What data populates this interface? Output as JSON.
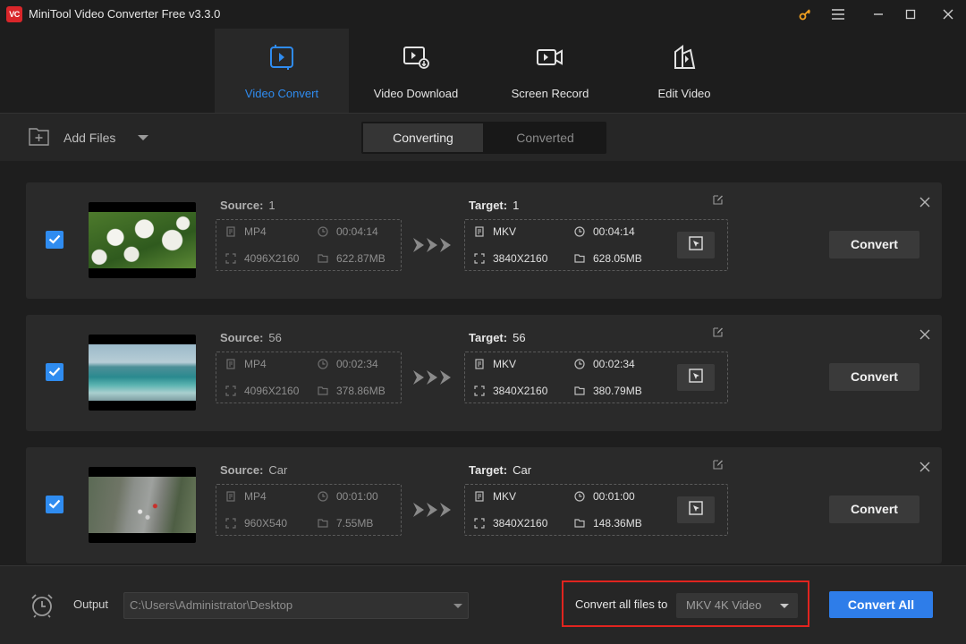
{
  "window": {
    "logo_text": "VC",
    "title": "MiniTool Video Converter Free v3.3.0"
  },
  "modules": [
    {
      "label": "Video Convert",
      "icon": "video-convert-icon",
      "active": true
    },
    {
      "label": "Video Download",
      "icon": "video-download-icon",
      "active": false
    },
    {
      "label": "Screen Record",
      "icon": "screen-record-icon",
      "active": false
    },
    {
      "label": "Edit Video",
      "icon": "edit-video-icon",
      "active": false
    }
  ],
  "toolbar": {
    "add_files_label": "Add Files",
    "tabs": [
      "Converting",
      "Converted"
    ],
    "active_tab": "Converting"
  },
  "files": [
    {
      "source_label": "Source:",
      "source_name": "1",
      "source_format": "MP4",
      "source_duration": "00:04:14",
      "source_resolution": "4096X2160",
      "source_size": "622.87MB",
      "target_label": "Target:",
      "target_name": "1",
      "target_format": "MKV",
      "target_duration": "00:04:14",
      "target_resolution": "3840X2160",
      "target_size": "628.05MB",
      "checked": true,
      "thumbnail": "white-flowers",
      "convert_label": "Convert"
    },
    {
      "source_label": "Source:",
      "source_name": "56",
      "source_format": "MP4",
      "source_duration": "00:02:34",
      "source_resolution": "4096X2160",
      "source_size": "378.86MB",
      "target_label": "Target:",
      "target_name": "56",
      "target_format": "MKV",
      "target_duration": "00:02:34",
      "target_resolution": "3840X2160",
      "target_size": "380.79MB",
      "checked": true,
      "thumbnail": "ocean-coast",
      "convert_label": "Convert"
    },
    {
      "source_label": "Source:",
      "source_name": "Car",
      "source_format": "MP4",
      "source_duration": "00:01:00",
      "source_resolution": "960X540",
      "source_size": "7.55MB",
      "target_label": "Target:",
      "target_name": "Car",
      "target_format": "MKV",
      "target_duration": "00:01:00",
      "target_resolution": "3840X2160",
      "target_size": "148.36MB",
      "checked": true,
      "thumbnail": "highway-cars",
      "convert_label": "Convert"
    }
  ],
  "footer": {
    "output_label": "Output",
    "output_path": "C:\\Users\\Administrator\\Desktop",
    "convert_all_files_label": "Convert all files to",
    "format_value": "MKV 4K Video",
    "convert_all_label": "Convert All"
  },
  "colors": {
    "accent": "#2f8cf0",
    "highlight_border": "#e0241f",
    "logo_red": "#d9262a",
    "key_icon": "#f0a020"
  }
}
